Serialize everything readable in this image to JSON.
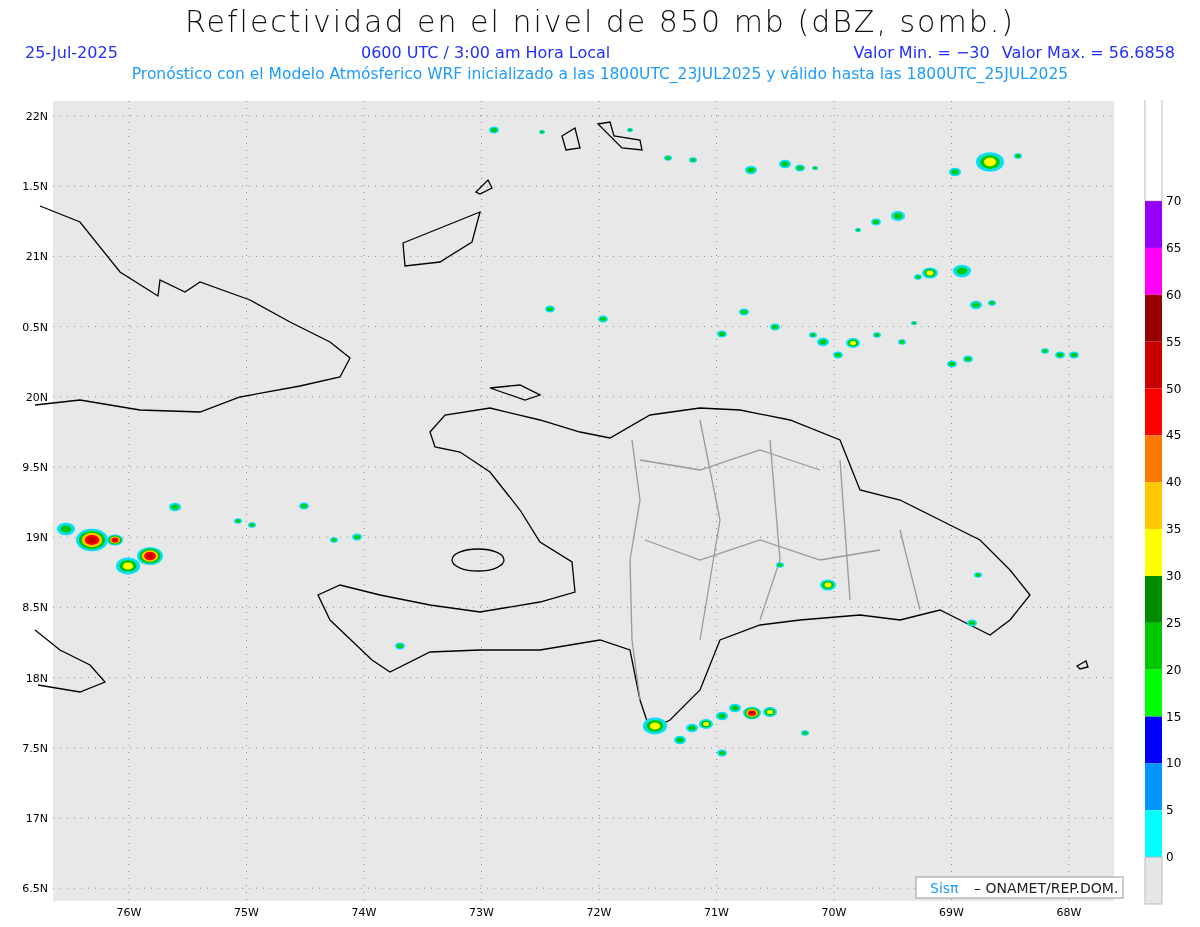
{
  "title": "Reflectividad en el nivel de 850 mb (dBZ, somb.)",
  "info": {
    "date": "25-Jul-2025",
    "time": "0600 UTC / 3:00 am Hora Local",
    "min": "Valor Min. = −30",
    "max": "Valor Max. = 56.6858"
  },
  "forecast": "Pronóstico con el Modelo Atmósferico WRF inicializado a las 1800UTC_23JUL2025 y válido hasta las  1800UTC_25JUL2025",
  "map": {
    "y_labels": [
      "22N",
      "1.5N",
      "21N",
      "0.5N",
      "20N",
      "9.5N",
      "19N",
      "8.5N",
      "18N",
      "7.5N",
      "17N",
      "6.5N"
    ],
    "x_labels": [
      "76W",
      "75W",
      "74W",
      "73W",
      "72W",
      "71W",
      "70W",
      "69W",
      "68W"
    ]
  },
  "colorbar": {
    "labels": [
      "70",
      "65",
      "60",
      "55",
      "50",
      "45",
      "40",
      "35",
      "30",
      "25",
      "20",
      "15",
      "10",
      "5",
      "0"
    ],
    "bins": [
      {
        "color": "#ffffff"
      },
      {
        "color": "#9600ff"
      },
      {
        "color": "#ff00ff"
      },
      {
        "color": "#960000"
      },
      {
        "color": "#c80000"
      },
      {
        "color": "#ff0000"
      },
      {
        "color": "#ff7800"
      },
      {
        "color": "#ffc800"
      },
      {
        "color": "#ffff00"
      },
      {
        "color": "#008c00"
      },
      {
        "color": "#00c800"
      },
      {
        "color": "#00ff00"
      },
      {
        "color": "#0000ff"
      },
      {
        "color": "#0096ff"
      },
      {
        "color": "#00ffff"
      },
      {
        "color": "#e6e6e6"
      }
    ]
  },
  "credit": {
    "brand": "Sisπ",
    "text": "– ONAMET/REP.DOM."
  }
}
